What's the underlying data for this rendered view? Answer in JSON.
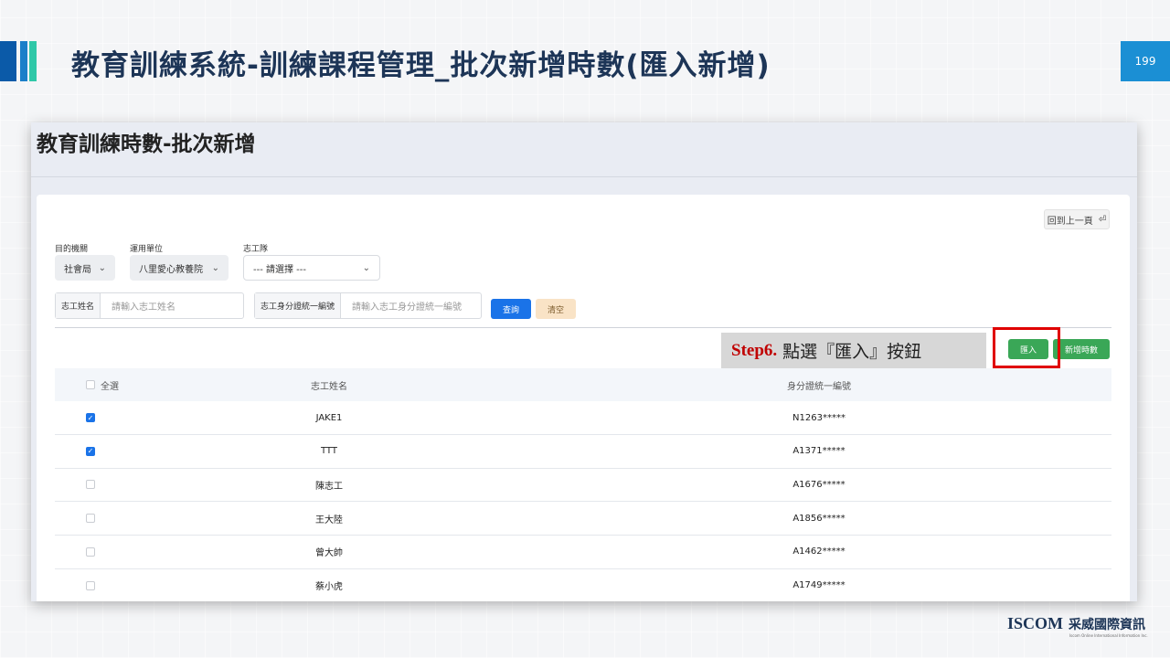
{
  "slide": {
    "title": "教育訓練系統-訓練課程管理_批次新增時數(匯入新增)",
    "page_number": "199",
    "logo_en": "ISCOM",
    "logo_zh": "采威國際資訊",
    "logo_sub": "Iscom Online International Information Inc."
  },
  "screen": {
    "title": "教育訓練時數-批次新增",
    "back_to_top_label": "回到上一頁",
    "filters": {
      "agency_label": "目的機關",
      "agency_value": "社會局",
      "unit_label": "運用單位",
      "unit_value": "八里愛心教養院",
      "team_label": "志工隊",
      "team_value": "--- 請選擇 ---"
    },
    "search": {
      "name_prefix": "志工姓名",
      "name_placeholder": "請輸入志工姓名",
      "id_prefix": "志工身分證統一編號",
      "id_placeholder": "請輸入志工身分證統一編號",
      "query_label": "查詢",
      "clear_label": "清空"
    },
    "annotation": {
      "step": "Step6.",
      "text": "點選『匯入』按鈕"
    },
    "actions": {
      "import_label": "匯入",
      "add_hours_label": "新增時數"
    },
    "table": {
      "select_all_label": "全選",
      "columns": [
        "志工姓名",
        "身分證統一編號"
      ],
      "rows": [
        {
          "checked": true,
          "name": "JAKE1",
          "id": "N1263*****"
        },
        {
          "checked": true,
          "name": "TTT",
          "id": "A1371*****"
        },
        {
          "checked": false,
          "name": "陳志工",
          "id": "A1676*****"
        },
        {
          "checked": false,
          "name": "王大陸",
          "id": "A1856*****"
        },
        {
          "checked": false,
          "name": "曾大帥",
          "id": "A1462*****"
        },
        {
          "checked": false,
          "name": "蔡小虎",
          "id": "A1749*****"
        }
      ]
    }
  },
  "colors": {
    "primary_blue": "#1a73e8",
    "success_green": "#3aa757",
    "highlight_red": "#e00000",
    "title_navy": "#1d3557"
  }
}
